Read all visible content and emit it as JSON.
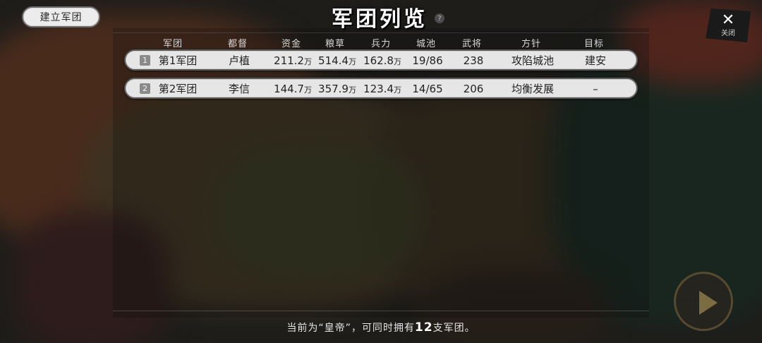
{
  "screen": {
    "title": "军团列览",
    "help_label": "?",
    "create_button_label": "建立军团",
    "close": {
      "icon": "close-icon",
      "label": "关闭"
    }
  },
  "table": {
    "headers": [
      "军团",
      "都督",
      "资金",
      "粮草",
      "兵力",
      "城池",
      "武将",
      "方针",
      "目标"
    ],
    "rows": [
      {
        "index": "1",
        "legion": "第1军团",
        "governor": "卢植",
        "funds": "211.2",
        "funds_unit": "万",
        "provisions": "514.4",
        "provisions_unit": "万",
        "troops": "162.8",
        "troops_unit": "万",
        "cities": "19/86",
        "generals": "238",
        "policy": "攻陷城池",
        "target": "建安"
      },
      {
        "index": "2",
        "legion": "第2军团",
        "governor": "李信",
        "funds": "144.7",
        "funds_unit": "万",
        "provisions": "357.9",
        "provisions_unit": "万",
        "troops": "123.4",
        "troops_unit": "万",
        "cities": "14/65",
        "generals": "206",
        "policy": "均衡发展",
        "target": "–"
      }
    ]
  },
  "footer": {
    "prefix": "当前为“皇帝”，可同时拥有",
    "count": "12",
    "suffix": "支军团。"
  },
  "colors": {
    "row_bg": "#e6e6e6",
    "row_border": "#5a5a5a",
    "title": "#ffffff"
  }
}
